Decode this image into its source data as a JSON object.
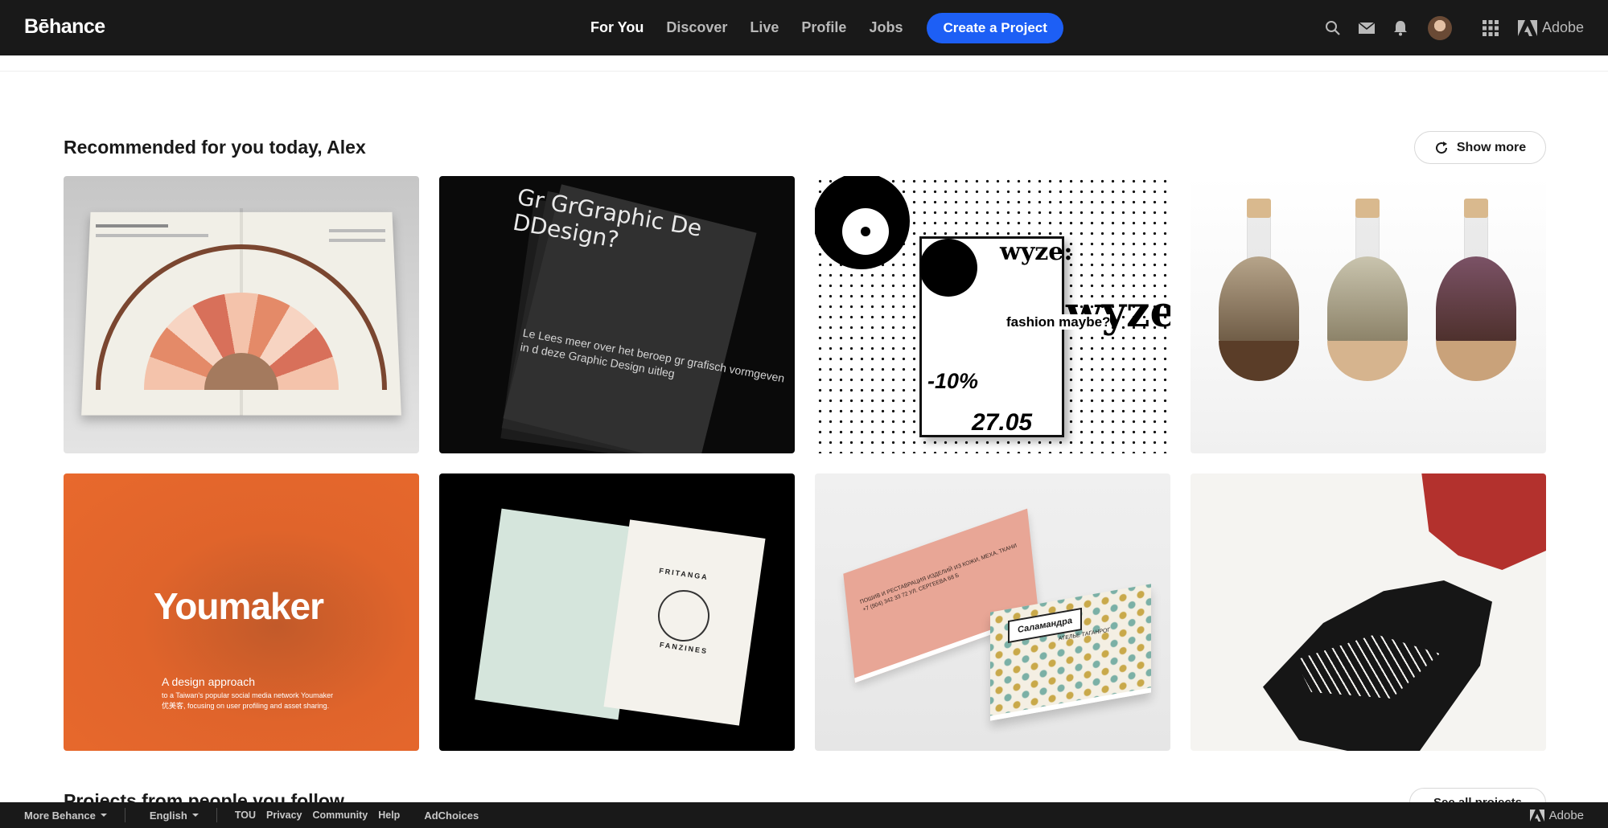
{
  "nav": {
    "logo": "Bēhance",
    "links": [
      "For You",
      "Discover",
      "Live",
      "Profile",
      "Jobs"
    ],
    "active_link": "For You",
    "create_label": "Create a Project",
    "adobe_label": "Adobe"
  },
  "icons": {
    "search": "search-icon",
    "messages": "mail-icon",
    "notifications": "bell-icon",
    "apps": "apps-grid-icon",
    "adobe": "adobe-logo-icon",
    "refresh": "refresh-icon"
  },
  "colors": {
    "nav_bg": "#191919",
    "accent": "#1d5ff5",
    "youmaker_orange": "#e0642b"
  },
  "section": {
    "title": "Recommended for you today, Alex",
    "show_more_label": "Show more"
  },
  "projects": [
    {
      "id": "infographic-book"
    },
    {
      "id": "graphic-design-poster",
      "headline": "Gr GrGraphic De DDesign?",
      "body": "Le Lees meer over het beroep gr grafisch vormgeven in d deze Graphic Design uitleg"
    },
    {
      "id": "wyze-fashion-poster",
      "brand": "wyze:",
      "question": "fashion maybe?",
      "discount": "-10%",
      "date": "27.05"
    },
    {
      "id": "tea-flasks"
    },
    {
      "id": "youmaker",
      "logo": "Youmaker",
      "line1": "A design approach",
      "line2": "to a Taiwan's popular social media network Youmaker",
      "line3": "优美客, focusing on user profiling and asset sharing."
    },
    {
      "id": "fritanga-fanzines",
      "top": "FRITANGA",
      "bottom": "FANZINES"
    },
    {
      "id": "salamandra-cards",
      "label": "Саламандра",
      "sublabel": "АТЕЛЬЕ   ТАГАНРОГ",
      "pink_text": "ПОШИВ И РЕСТАВРАЦИЯ ИЗДЕЛИЙ ИЗ КОЖИ, МЕХА, ТКАНИ +7 (904) 342 33 72 УЛ. СЕРГЕЕВА 68 Б"
    },
    {
      "id": "woodcut-hand"
    }
  ],
  "next_section": {
    "title": "Projects from people you follow",
    "see_all_label": "See all projects"
  },
  "footer": {
    "more_label": "More Behance",
    "language": "English",
    "links": [
      "TOU",
      "Privacy",
      "Community",
      "Help"
    ],
    "adchoices": "AdChoices",
    "adobe_label": "Adobe"
  }
}
